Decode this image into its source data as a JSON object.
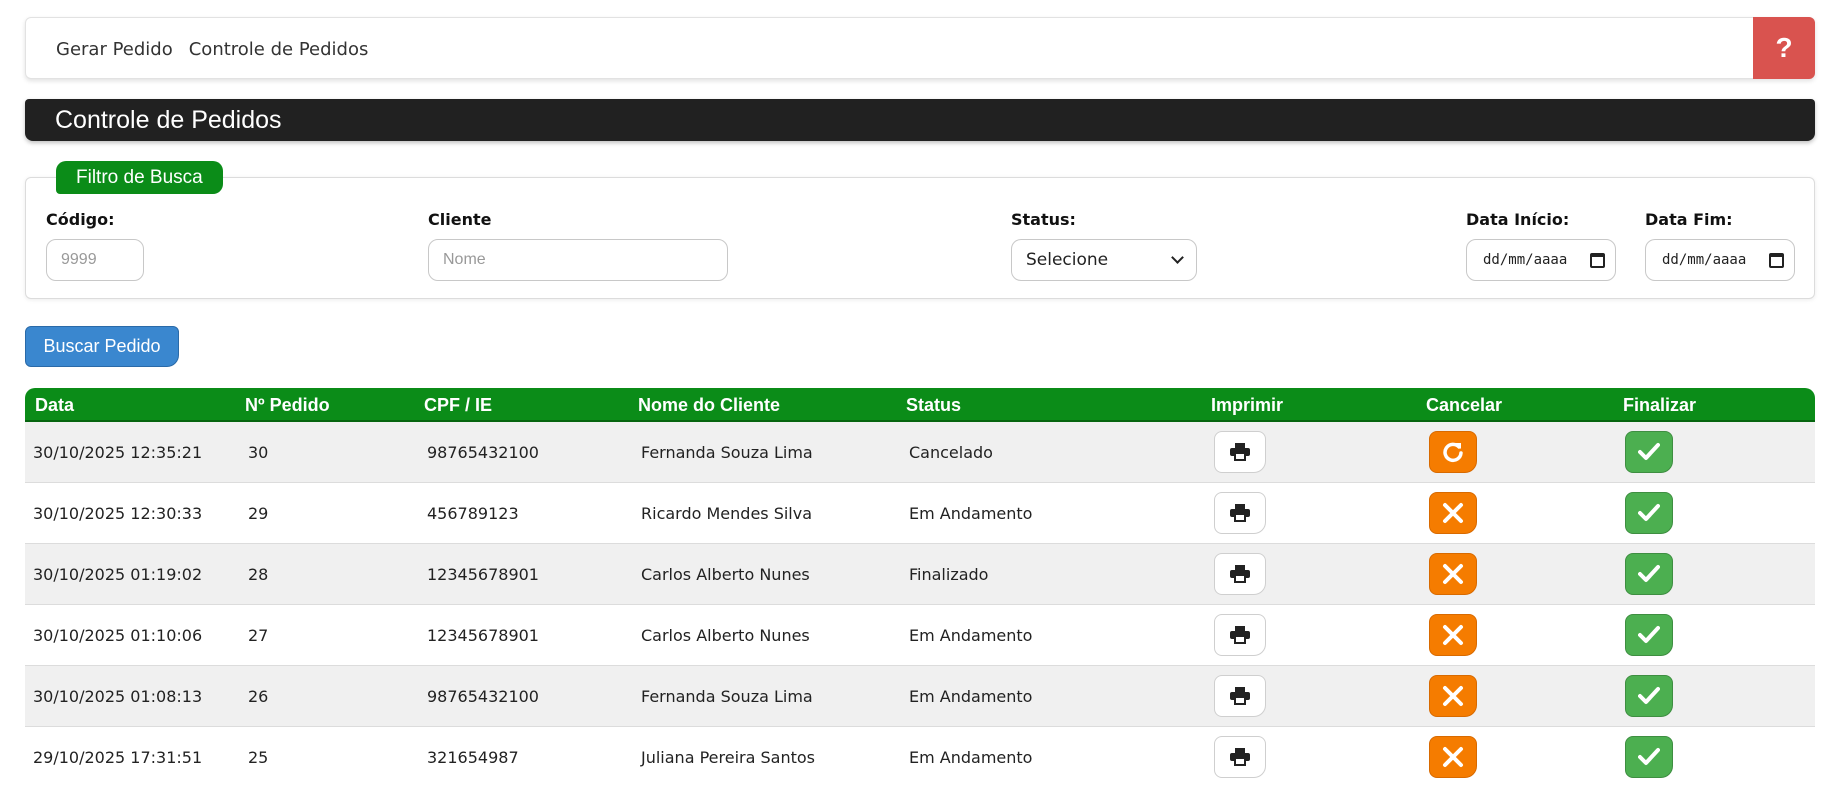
{
  "nav": {
    "links": [
      "Gerar Pedido",
      "Controle de Pedidos"
    ],
    "help_label": "?"
  },
  "page": {
    "title": "Controle de Pedidos"
  },
  "filter": {
    "legend": "Filtro de Busca",
    "codigo": {
      "label": "Código:",
      "placeholder": "9999"
    },
    "cliente": {
      "label": "Cliente",
      "placeholder": "Nome"
    },
    "status": {
      "label": "Status:",
      "selected": "Selecione"
    },
    "data_inicio": {
      "label": "Data Início:",
      "value": "dd/mm/aaaa"
    },
    "data_fim": {
      "label": "Data Fim:",
      "value": "dd/mm/aaaa"
    }
  },
  "search_button": "Buscar Pedido",
  "table": {
    "headers": [
      "Data",
      "Nº Pedido",
      "CPF / IE",
      "Nome do Cliente",
      "Status",
      "Imprimir",
      "Cancelar",
      "Finalizar"
    ],
    "rows": [
      {
        "data": "30/10/2025 12:35:21",
        "pedido": "30",
        "cpf": "98765432100",
        "cliente": "Fernanda Souza Lima",
        "status": "Cancelado",
        "cancel_icon": "redo-icon"
      },
      {
        "data": "30/10/2025 12:30:33",
        "pedido": "29",
        "cpf": "456789123",
        "cliente": "Ricardo Mendes Silva",
        "status": "Em Andamento",
        "cancel_icon": "close-icon"
      },
      {
        "data": "30/10/2025 01:19:02",
        "pedido": "28",
        "cpf": "12345678901",
        "cliente": "Carlos Alberto Nunes",
        "status": "Finalizado",
        "cancel_icon": "close-icon"
      },
      {
        "data": "30/10/2025 01:10:06",
        "pedido": "27",
        "cpf": "12345678901",
        "cliente": "Carlos Alberto Nunes",
        "status": "Em Andamento",
        "cancel_icon": "close-icon"
      },
      {
        "data": "30/10/2025 01:08:13",
        "pedido": "26",
        "cpf": "98765432100",
        "cliente": "Fernanda Souza Lima",
        "status": "Em Andamento",
        "cancel_icon": "close-icon"
      },
      {
        "data": "29/10/2025 17:31:51",
        "pedido": "25",
        "cpf": "321654987",
        "cliente": "Juliana Pereira Santos",
        "status": "Em Andamento",
        "cancel_icon": "close-icon"
      }
    ]
  },
  "colors": {
    "header_green": "#0b8c18",
    "cancel_orange": "#f57c00",
    "finish_green": "#4caf50",
    "help_red": "#d9534f",
    "search_blue": "#3a87cf"
  }
}
